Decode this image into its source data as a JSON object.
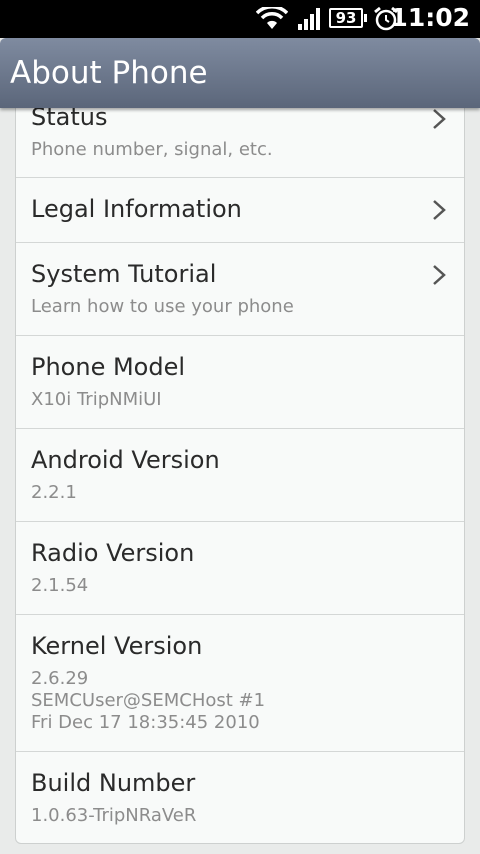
{
  "status_bar": {
    "battery": "93",
    "time": "11:02",
    "icons": [
      "wifi-icon",
      "signal-icon",
      "battery-icon",
      "alarm-icon"
    ]
  },
  "header": {
    "title": "About Phone"
  },
  "items": [
    {
      "title": "Status",
      "subtitle": "Phone number, signal, etc.",
      "has_chevron": true
    },
    {
      "title": "Legal Information",
      "subtitle": "",
      "has_chevron": true
    },
    {
      "title": "System Tutorial",
      "subtitle": "Learn how to use your phone",
      "has_chevron": true
    },
    {
      "title": "Phone Model",
      "subtitle": "X10i TripNMiUI",
      "has_chevron": false
    },
    {
      "title": "Android Version",
      "subtitle": "2.2.1",
      "has_chevron": false
    },
    {
      "title": "Radio Version",
      "subtitle": "2.1.54",
      "has_chevron": false
    },
    {
      "title": "Kernel Version",
      "subtitle": "2.6.29\nSEMCUser@SEMCHost #1\nFri Dec 17 18:35:45 2010",
      "has_chevron": false
    },
    {
      "title": "Build Number",
      "subtitle": "1.0.63-TripNRaVeR",
      "has_chevron": false
    }
  ],
  "colors": {
    "title_bar": "#6b768a",
    "list_bg": "#f8faf9",
    "primary_text": "#2a2a2a",
    "secondary_text": "#8c8c8c"
  }
}
